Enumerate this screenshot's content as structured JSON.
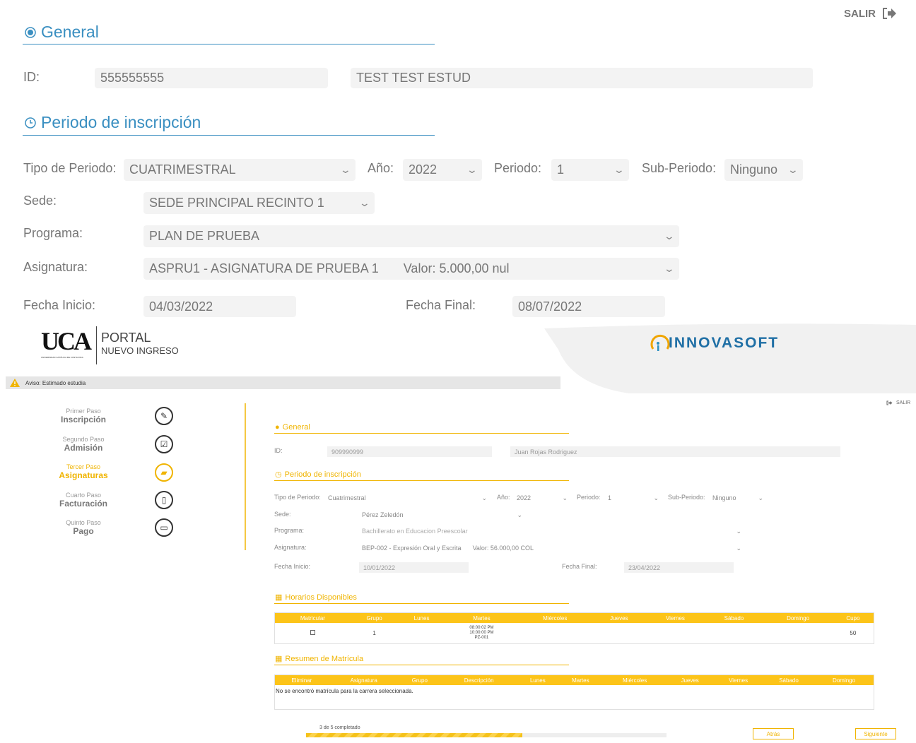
{
  "top": {
    "salir": "SALIR",
    "general": {
      "title": "General",
      "id_label": "ID:",
      "id_value": "555555555",
      "name_value": "TEST TEST ESTUD"
    },
    "periodo": {
      "title": "Periodo de inscripción",
      "tipo_label": "Tipo de Periodo:",
      "tipo_value": "CUATRIMESTRAL",
      "anio_label": "Año:",
      "anio_value": "2022",
      "periodo_label": "Periodo:",
      "periodo_value": "1",
      "sub_label": "Sub-Periodo:",
      "sub_value": "Ninguno",
      "sede_label": "Sede:",
      "sede_value": "SEDE PRINCIPAL RECINTO 1",
      "programa_label": "Programa:",
      "programa_value": "PLAN DE PRUEBA",
      "asignatura_label": "Asignatura:",
      "asignatura_value": "ASPRU1 - ASIGNATURA DE PRUEBA 1",
      "asignatura_valor": "Valor: 5.000,00 nul",
      "fi_label": "Fecha Inicio:",
      "fi_value": "04/03/2022",
      "ff_label": "Fecha Final:",
      "ff_value": "08/07/2022"
    }
  },
  "header": {
    "portal": "PORTAL",
    "nuevo": "NUEVO INGRESO",
    "uca_small": "UNIVERSIDAD CATÓLICA DE COSTA RICA",
    "brand": "INNOVASOFT",
    "aviso": "Aviso: Estimado estudia"
  },
  "steps": [
    {
      "n": "Primer Paso",
      "t": "Inscripción",
      "icon": "pencil-icon",
      "glyph": "✎"
    },
    {
      "n": "Segundo Paso",
      "t": "Admisión",
      "icon": "check-box-icon",
      "glyph": "☑"
    },
    {
      "n": "Tercer Paso",
      "t": "Asignaturas",
      "icon": "book-icon",
      "glyph": "▰"
    },
    {
      "n": "Cuarto Paso",
      "t": "Facturación",
      "icon": "document-icon",
      "glyph": "▯"
    },
    {
      "n": "Quinto Paso",
      "t": "Pago",
      "icon": "card-icon",
      "glyph": "▭"
    }
  ],
  "bottom": {
    "salir": "SALIR",
    "general": {
      "title": "General",
      "id_label": "ID:",
      "id_value": "909990999",
      "name_value": "Juan Rojas Rodriguez"
    },
    "periodo": {
      "title": "Periodo de inscripción",
      "tipo_label": "Tipo de Periodo:",
      "tipo_value": "Cuatrimestral",
      "anio_label": "Año:",
      "anio_value": "2022",
      "periodo_label": "Periodo:",
      "periodo_value": "1",
      "sub_label": "Sub-Periodo:",
      "sub_value": "Ninguno",
      "sede_label": "Sede:",
      "sede_value": "Pérez Zeledón",
      "programa_label": "Programa:",
      "programa_value": "Bachillerato en Educacion Preescolar",
      "asignatura_label": "Asignatura:",
      "asignatura_value": "BEP-002 - Expresión Oral y Escrita",
      "asignatura_valor": "Valor: 56.000,00 COL",
      "fi_label": "Fecha Inicio:",
      "fi_value": "10/01/2022",
      "ff_label": "Fecha Final:",
      "ff_value": "23/04/2022"
    },
    "horarios": {
      "title": "Horarios Disponibles",
      "headers": [
        "Matricular",
        "Grupo",
        "Lunes",
        "Martes",
        "Miércoles",
        "Jueves",
        "Viernes",
        "Sábado",
        "Domingo",
        "Cupo"
      ],
      "row": {
        "grupo": "1",
        "martes1": "08:00:02 PM",
        "martes2": "10:00:00 PM",
        "martes3": "PZ-001",
        "cupo": "50"
      }
    },
    "resumen": {
      "title": "Resumen de Matrícula",
      "headers": [
        "Eliminar",
        "Asignatura",
        "Grupo",
        "Descripción",
        "Lunes",
        "Martes",
        "Miércoles",
        "Jueves",
        "Viernes",
        "Sábado",
        "Domingo"
      ],
      "empty": "No se encontró matrícula para la carrera seleccionada."
    },
    "progress": {
      "label": "3 de 5 completado",
      "value": 0.6
    },
    "atras": "Atrás",
    "siguiente": "Siguiente"
  }
}
